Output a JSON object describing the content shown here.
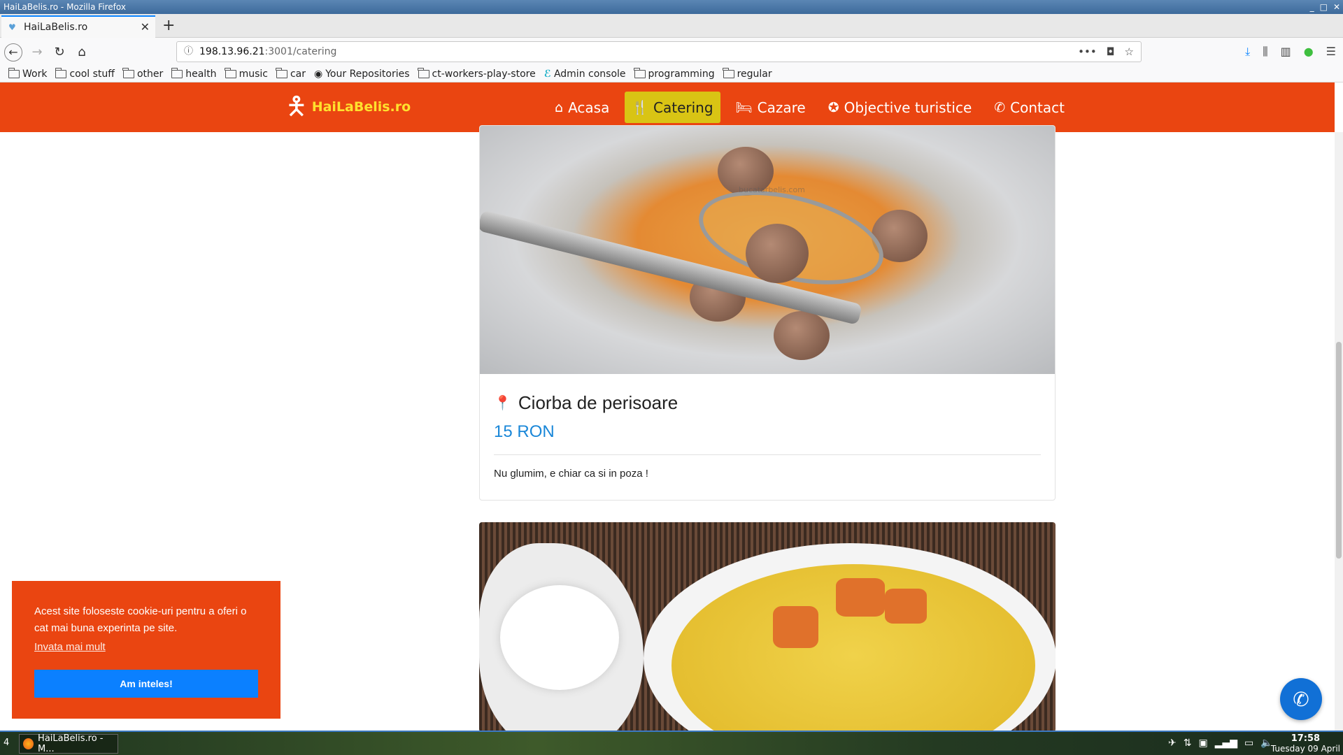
{
  "window": {
    "title": "HaiLaBelis.ro - Mozilla Firefox",
    "controls": [
      "_",
      "□",
      "✕"
    ]
  },
  "browser": {
    "tab_title": "HaiLaBelis.ro",
    "new_tab": "+",
    "url_host": "198.13.96.21",
    "url_path": ":3001/catering",
    "bookmarks": [
      {
        "label": "Work",
        "icon": "folder-icon"
      },
      {
        "label": "cool stuff",
        "icon": "folder-icon"
      },
      {
        "label": "other",
        "icon": "folder-icon"
      },
      {
        "label": "health",
        "icon": "folder-icon"
      },
      {
        "label": "music",
        "icon": "folder-icon"
      },
      {
        "label": "car",
        "icon": "folder-icon"
      },
      {
        "label": "Your Repositories",
        "icon": "github-icon"
      },
      {
        "label": "ct-workers-play-store",
        "icon": "folder-icon"
      },
      {
        "label": "Admin console",
        "icon": "admin-console-icon"
      },
      {
        "label": "programming",
        "icon": "folder-icon"
      },
      {
        "label": "regular",
        "icon": "folder-icon"
      }
    ]
  },
  "site": {
    "brand": "HaiLaBelis.ro",
    "colors": {
      "nav": "#ea4511",
      "active": "#d9c414",
      "brand_text": "#ffe12e",
      "price": "#1a87d8",
      "cookie_btn": "#0b80ff"
    },
    "menu": [
      {
        "label": "Acasa",
        "icon": "home-icon",
        "active": false
      },
      {
        "label": "Catering",
        "icon": "utensils-icon",
        "active": true
      },
      {
        "label": "Cazare",
        "icon": "bed-icon",
        "active": false
      },
      {
        "label": "Objective turistice",
        "icon": "compass-icon",
        "active": false
      },
      {
        "label": "Contact",
        "icon": "phone-icon",
        "active": false
      }
    ],
    "dishes": [
      {
        "title": "Ciorba de perisoare",
        "price": "15 RON",
        "description": "Nu glumim, e chiar ca si in poza !",
        "watermark": "bucatarbelis.com"
      }
    ],
    "cookie": {
      "text": "Acest site foloseste cookie-uri pentru a oferi o cat mai buna experinta pe site.",
      "link": "Invata mai mult",
      "button": "Am inteles!"
    }
  },
  "taskbar": {
    "workspace": "4",
    "task": "HaiLaBelis.ro - M...",
    "time": "17:58",
    "date": "Tuesday 09 April"
  }
}
